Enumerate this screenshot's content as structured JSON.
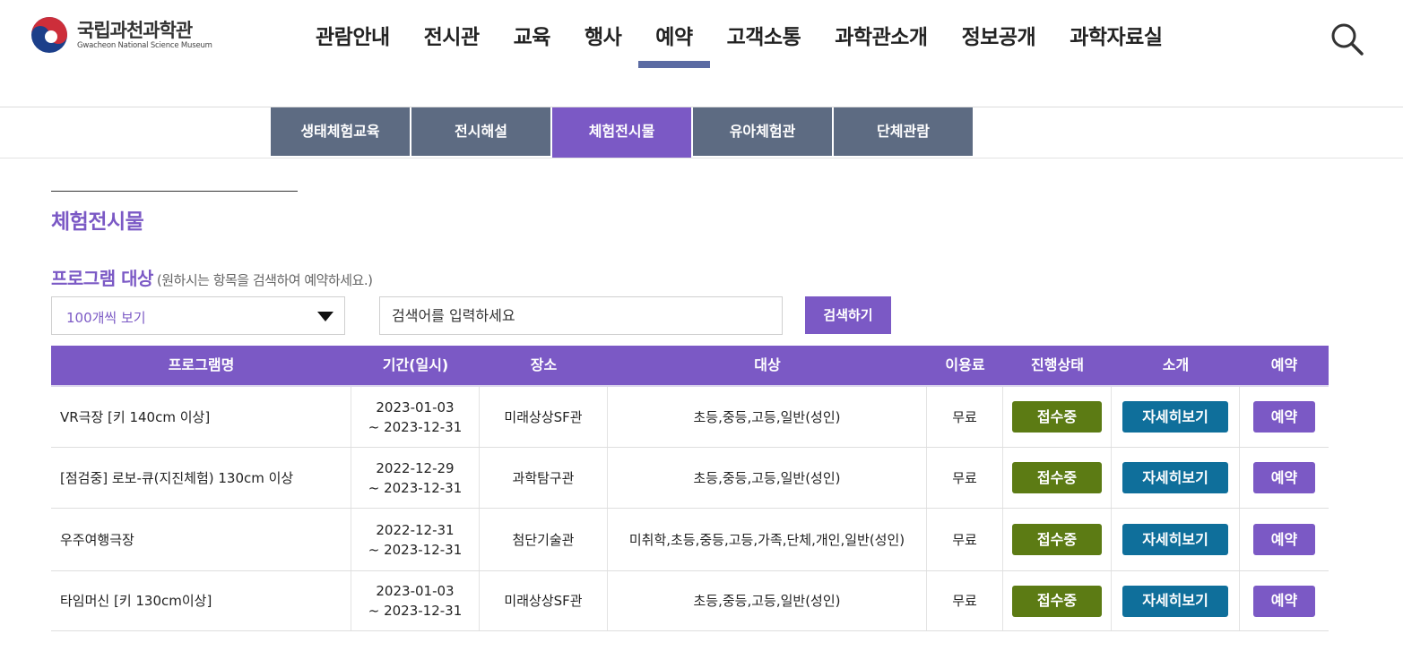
{
  "logo": {
    "name_kr": "국립과천과학관",
    "name_en": "Gwacheon National Science Museum"
  },
  "gnb": {
    "items": [
      "관람안내",
      "전시관",
      "교육",
      "행사",
      "예약",
      "고객소통",
      "과학관소개",
      "정보공개",
      "과학자료실"
    ],
    "active": "예약"
  },
  "subnav": {
    "tabs": [
      "생태체험교육",
      "전시해설",
      "체험전시물",
      "유아체험관",
      "단체관람"
    ],
    "active": "체험전시물"
  },
  "page": {
    "title": "체험전시물"
  },
  "filter": {
    "label": "프로그램 대상",
    "hint": "(원하시는 항목을 검색하여 예약하세요.)",
    "select_value": "100개씩 보기",
    "search_placeholder": "검색어를 입력하세요",
    "search_button": "검색하기"
  },
  "table": {
    "headers": [
      "프로그램명",
      "기간(일시)",
      "장소",
      "대상",
      "이용료",
      "진행상태",
      "소개",
      "예약"
    ],
    "rows": [
      {
        "name": "VR극장 [키 140cm 이상]",
        "period_start": "2023-01-03",
        "period_end": "~ 2023-12-31",
        "place": "미래상상SF관",
        "target": "초등,중등,고등,일반(성인)",
        "fee": "무료",
        "status": "접수중",
        "detail": "자세히보기",
        "reserve": "예약"
      },
      {
        "name": "[점검중] 로보-큐(지진체험) 130cm 이상",
        "period_start": "2022-12-29",
        "period_end": "~ 2023-12-31",
        "place": "과학탐구관",
        "target": "초등,중등,고등,일반(성인)",
        "fee": "무료",
        "status": "접수중",
        "detail": "자세히보기",
        "reserve": "예약"
      },
      {
        "name": "우주여행극장",
        "period_start": "2022-12-31",
        "period_end": "~ 2023-12-31",
        "place": "첨단기술관",
        "target": "미취학,초등,중등,고등,가족,단체,개인,일반(성인)",
        "fee": "무료",
        "status": "접수중",
        "detail": "자세히보기",
        "reserve": "예약"
      },
      {
        "name": "타임머신 [키 130cm이상]",
        "period_start": "2023-01-03",
        "period_end": "~ 2023-12-31",
        "place": "미래상상SF관",
        "target": "초등,중등,고등,일반(성인)",
        "fee": "무료",
        "status": "접수중",
        "detail": "자세히보기",
        "reserve": "예약"
      }
    ]
  },
  "colors": {
    "accent": "#7b59c5",
    "subnav": "#5d6b82",
    "status_green": "#5c7b14",
    "detail_blue": "#0f6f9b"
  }
}
